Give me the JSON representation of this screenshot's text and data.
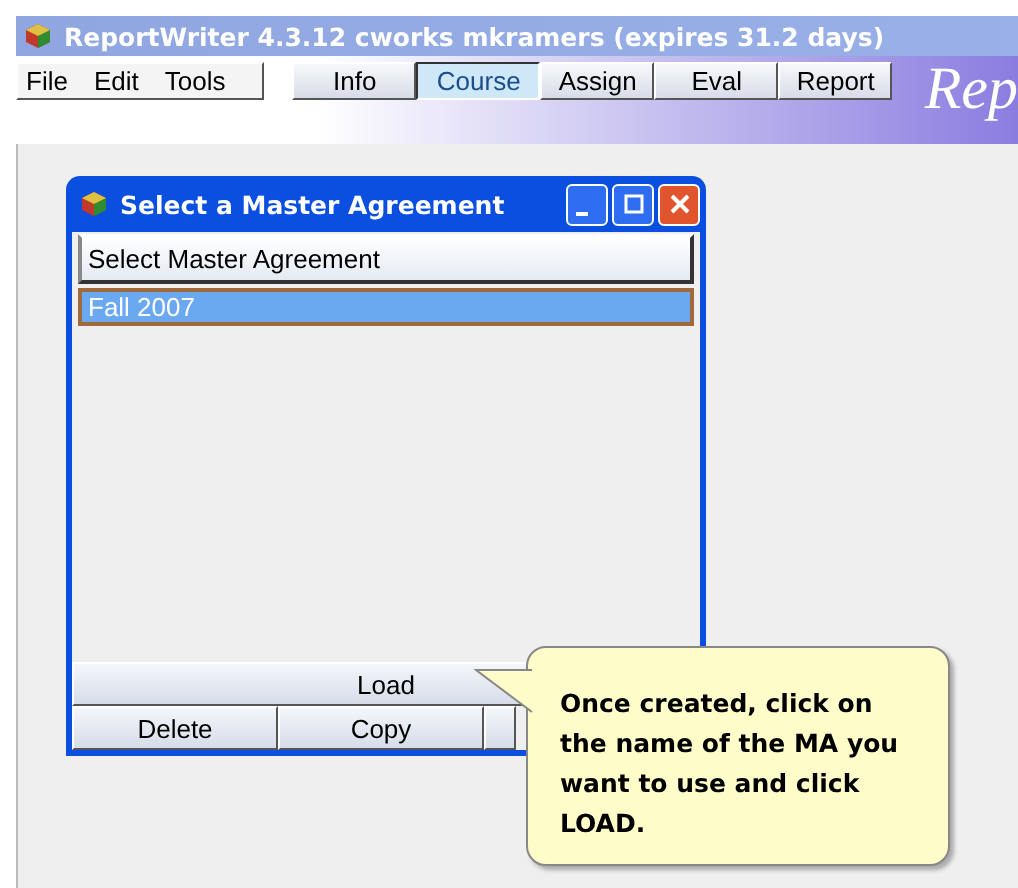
{
  "window": {
    "title": "ReportWriter 4.3.12  cworks mkramers (expires 31.2 days)"
  },
  "menu": [
    "File",
    "Edit",
    "Tools"
  ],
  "tabs": [
    {
      "label": "Info",
      "selected": false
    },
    {
      "label": "Course",
      "selected": true
    },
    {
      "label": "Assign",
      "selected": false
    },
    {
      "label": "Eval",
      "selected": false
    },
    {
      "label": "Report",
      "selected": false
    }
  ],
  "banner": {
    "text": "Rep"
  },
  "dialog": {
    "title": "Select a Master Agreement",
    "header": "Select Master Agreement",
    "items": [
      {
        "label": "Fall 2007",
        "selected": true
      }
    ],
    "load_button": "Load",
    "buttons": [
      "Delete",
      "Copy"
    ]
  },
  "callout": {
    "text": "Once created, click on the name of the MA you want to use and click LOAD."
  }
}
